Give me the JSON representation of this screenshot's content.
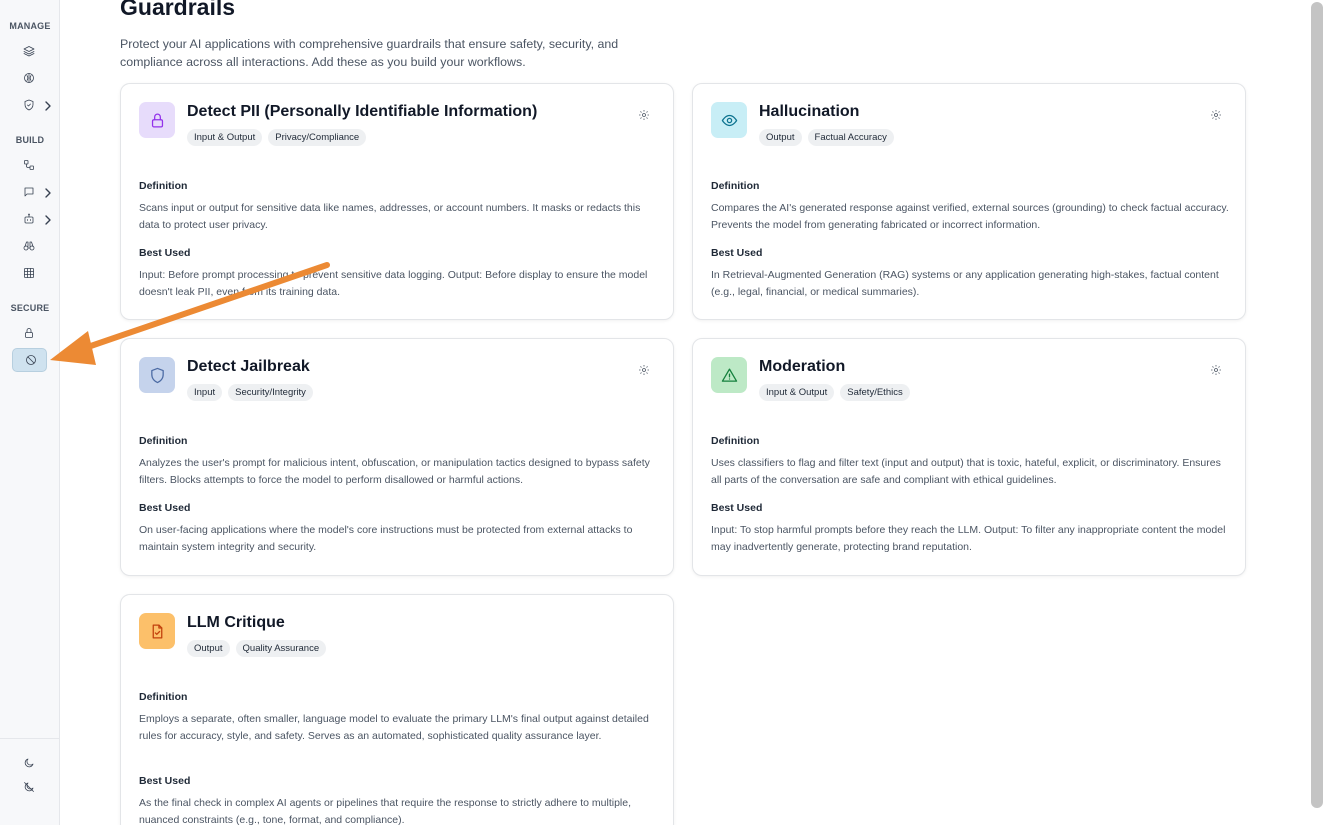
{
  "sidebar": {
    "sections": [
      {
        "label": "MANAGE"
      },
      {
        "label": "BUILD"
      },
      {
        "label": "SECURE"
      }
    ],
    "items": [
      {
        "icon": "layers-icon"
      },
      {
        "icon": "model-icon"
      },
      {
        "icon": "shield-check-icon"
      },
      {
        "icon": "workflow-icon"
      },
      {
        "icon": "chat-icon"
      },
      {
        "icon": "bot-icon"
      },
      {
        "icon": "binoculars-icon"
      },
      {
        "icon": "grid-icon"
      },
      {
        "icon": "lock-icon"
      },
      {
        "icon": "ban-icon"
      },
      {
        "icon": "moon-icon"
      },
      {
        "icon": "moon-off-icon"
      }
    ]
  },
  "page": {
    "title": "Guardrails",
    "description": "Protect your AI applications with comprehensive guardrails that ensure safety, security, and compliance across all interactions. Add these as you build your workflows."
  },
  "labels": {
    "definition": "Definition",
    "best_used": "Best Used"
  },
  "cards": [
    {
      "title": "Detect PII (Personally Identifiable Information)",
      "tags": [
        "Input & Output",
        "Privacy/Compliance"
      ],
      "icon": "lock-icon",
      "icon_bg": "#e7dcfb",
      "icon_color": "#9333ea",
      "definition": "Scans input or output for sensitive data like names, addresses, or account numbers. It masks or redacts this data to protect user privacy.",
      "best_used": "Input: Before prompt processing to prevent sensitive data logging. Output: Before display to ensure the model doesn't leak PII, even from its training data."
    },
    {
      "title": "Hallucination",
      "tags": [
        "Output",
        "Factual Accuracy"
      ],
      "icon": "eye-icon",
      "icon_bg": "#c8eef6",
      "icon_color": "#0e7490",
      "definition": "Compares the AI's generated response against verified, external sources (grounding) to check factual accuracy. Prevents the model from generating fabricated or incorrect information.",
      "best_used": "In Retrieval-Augmented Generation (RAG) systems or any application generating high-stakes, factual content (e.g., legal, financial, or medical summaries)."
    },
    {
      "title": "Detect Jailbreak",
      "tags": [
        "Input",
        "Security/Integrity"
      ],
      "icon": "shield-icon",
      "icon_bg": "#c5d3ec",
      "icon_color": "#4b6aa3",
      "definition": "Analyzes the user's prompt for malicious intent, obfuscation, or manipulation tactics designed to bypass safety filters. Blocks attempts to force the model to perform disallowed or harmful actions.",
      "best_used": "On user-facing applications where the model's core instructions must be protected from external attacks to maintain system integrity and security."
    },
    {
      "title": "Moderation",
      "tags": [
        "Input & Output",
        "Safety/Ethics"
      ],
      "icon": "warning-triangle-icon",
      "icon_bg": "#bde9c6",
      "icon_color": "#15803d",
      "definition": "Uses classifiers to flag and filter text (input and output) that is toxic, hateful, explicit, or discriminatory. Ensures all parts of the conversation are safe and compliant with ethical guidelines.",
      "best_used": "Input: To stop harmful prompts before they reach the LLM. Output: To filter any inappropriate content the model may inadvertently generate, protecting brand reputation."
    },
    {
      "title": "LLM Critique",
      "tags": [
        "Output",
        "Quality Assurance"
      ],
      "icon": "file-check-icon",
      "icon_bg": "#fcc06a",
      "icon_color": "#c2410c",
      "definition": "Employs a separate, often smaller, language model to evaluate the primary LLM's final output against detailed rules for accuracy, style, and safety. Serves as an automated, sophisticated quality assurance layer.",
      "best_used": "As the final check in complex AI agents or pipelines that require the response to strictly adhere to multiple, nuanced constraints (e.g., tone, format, and compliance)."
    }
  ],
  "annotation": {
    "color": "#ec8a34"
  }
}
